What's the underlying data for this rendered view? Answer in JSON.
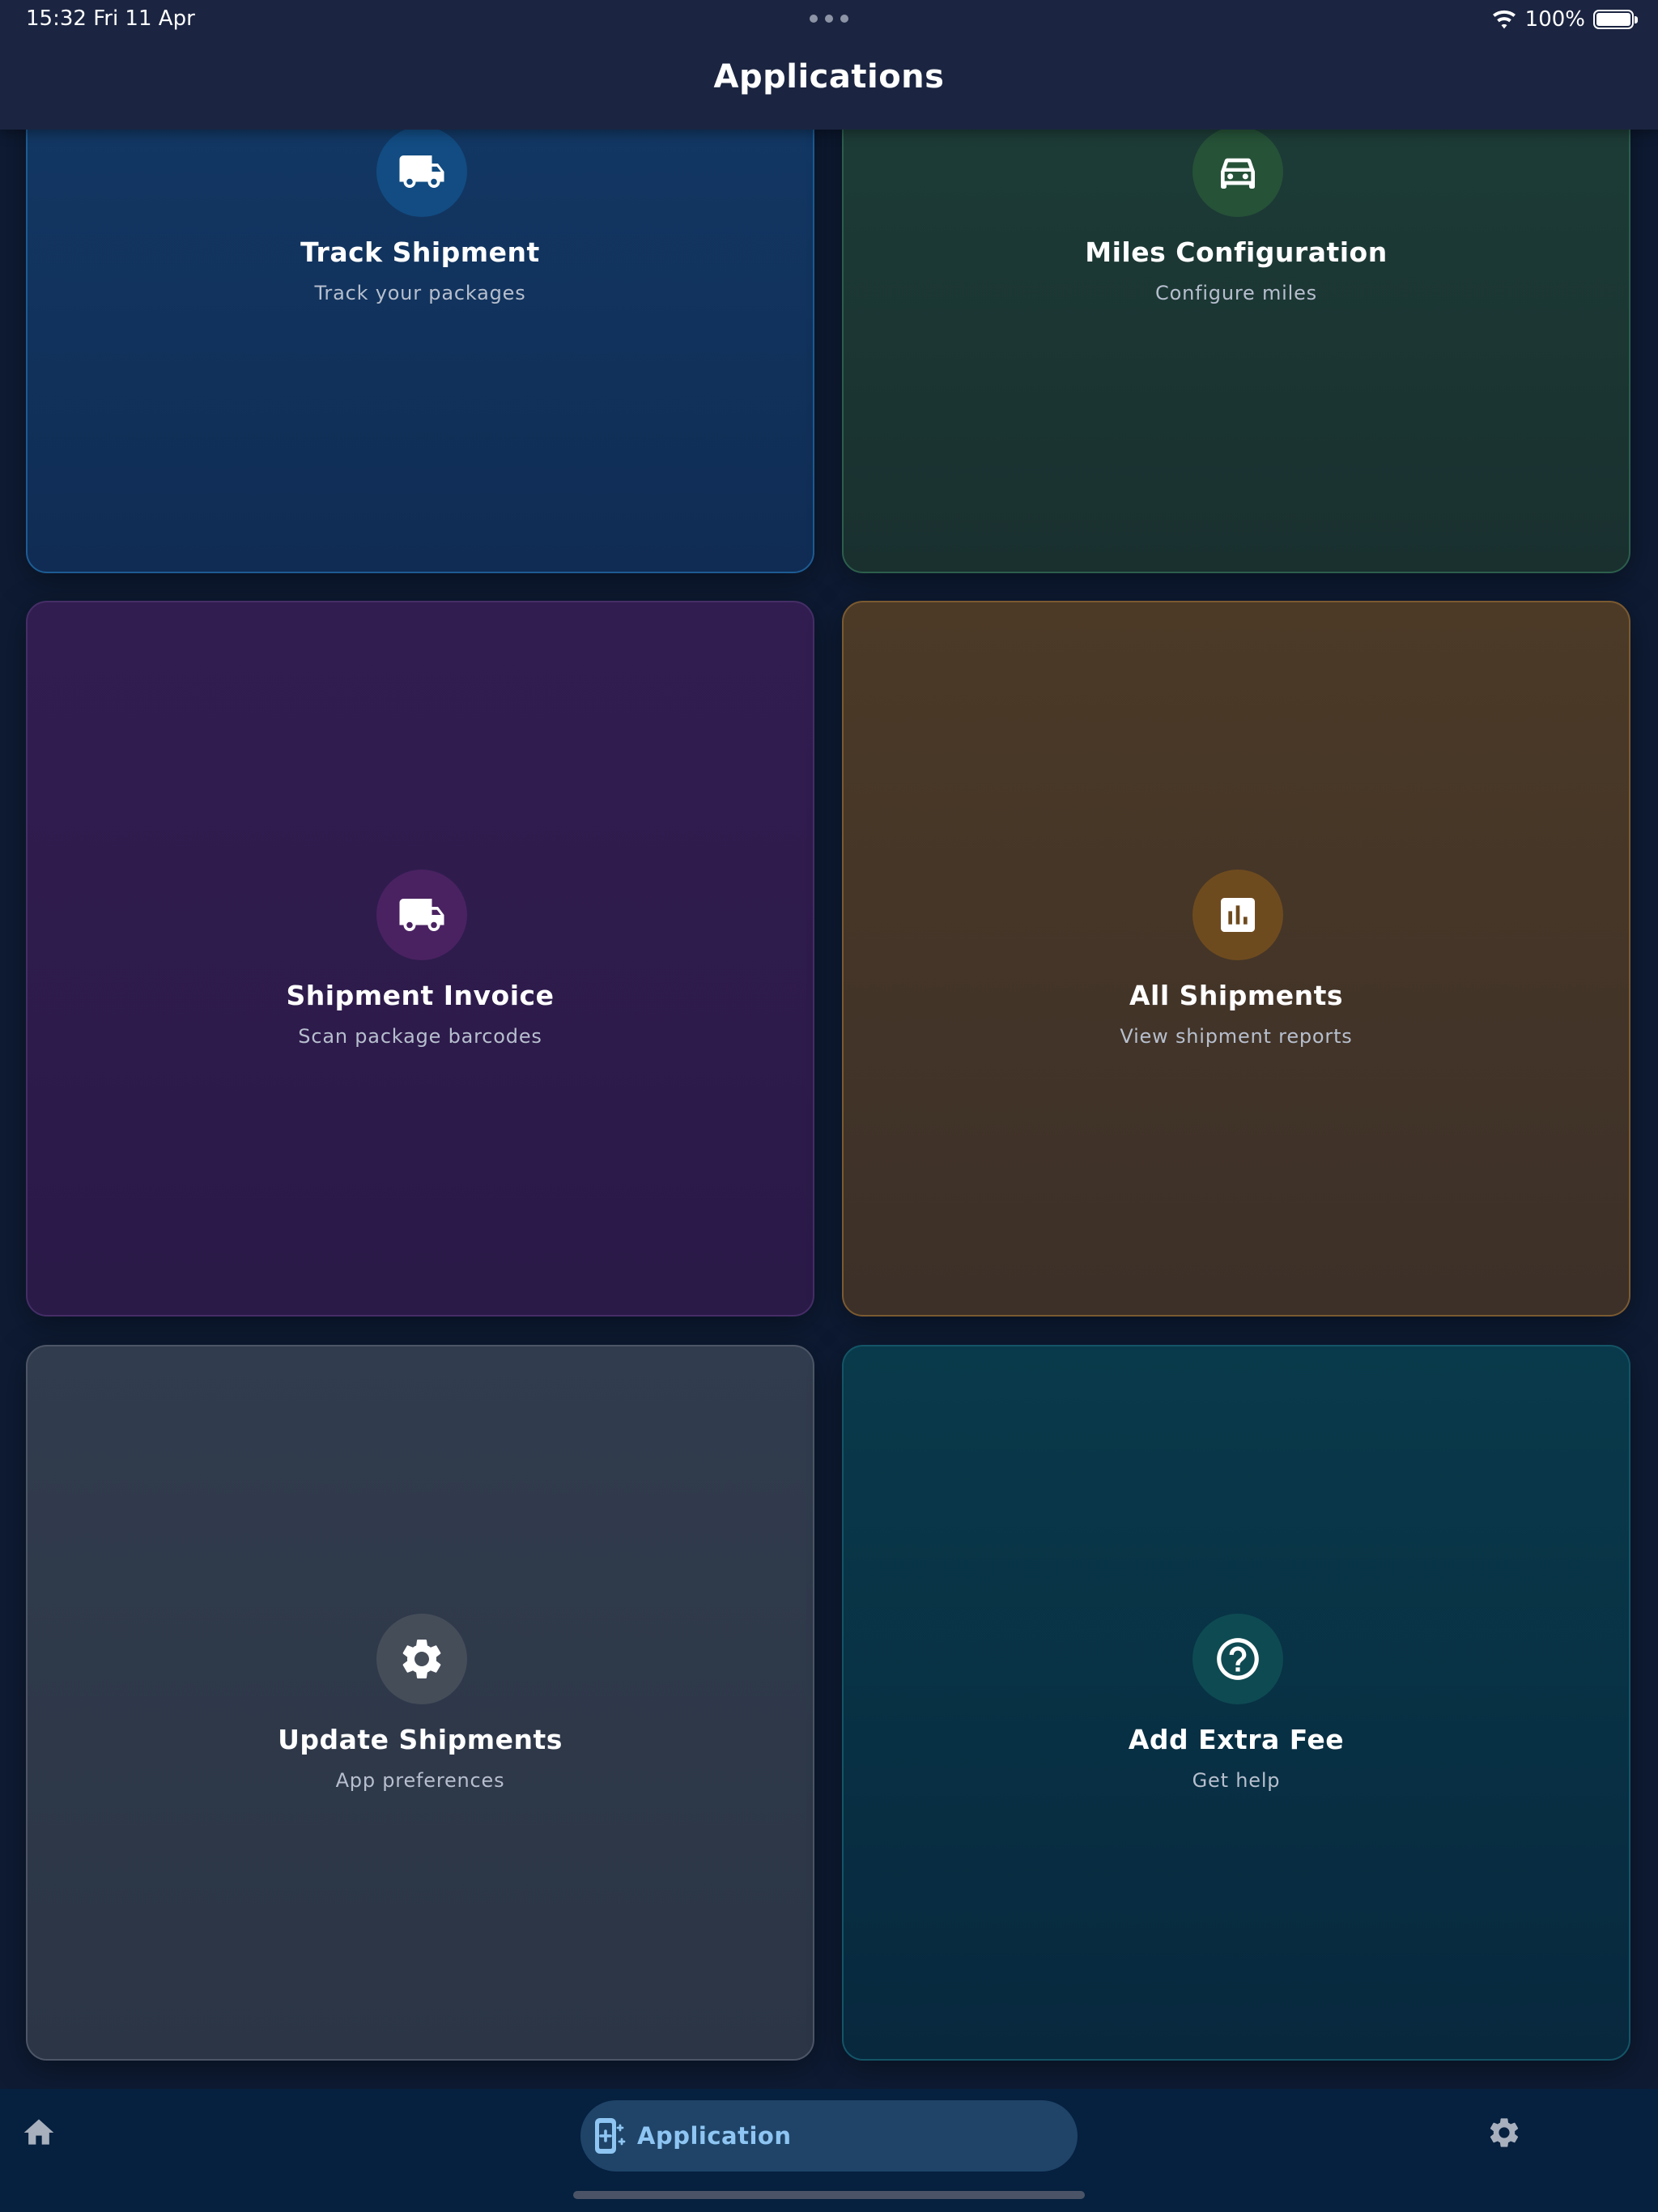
{
  "status_bar": {
    "time_date": "15:32   Fri 11 Apr",
    "battery_percent": "100%",
    "battery_level": 1.0
  },
  "header": {
    "title": "Applications"
  },
  "cards": [
    {
      "title": "Track Shipment",
      "subtitle": "Track your packages",
      "icon": "truck-icon",
      "accent": "#124c82"
    },
    {
      "title": "Miles Configuration",
      "subtitle": "Configure miles",
      "icon": "car-icon",
      "accent": "#265238"
    },
    {
      "title": "Shipment Invoice",
      "subtitle": "Scan package barcodes",
      "icon": "truck-icon",
      "accent": "#4a2261"
    },
    {
      "title": "All Shipments",
      "subtitle": "View shipment reports",
      "icon": "bar-chart-icon",
      "accent": "#6e4b1f"
    },
    {
      "title": "Update Shipments",
      "subtitle": "App preferences",
      "icon": "gear-icon",
      "accent": "#454d59"
    },
    {
      "title": "Add Extra Fee",
      "subtitle": "Get help",
      "icon": "help-circle-icon",
      "accent": "#0e4a52"
    }
  ],
  "bottom_nav": {
    "home_icon": "home-icon",
    "active_label": "Application",
    "active_icon": "app-add-icon",
    "settings_icon": "gear-icon",
    "active_color": "#8ec5f2"
  }
}
